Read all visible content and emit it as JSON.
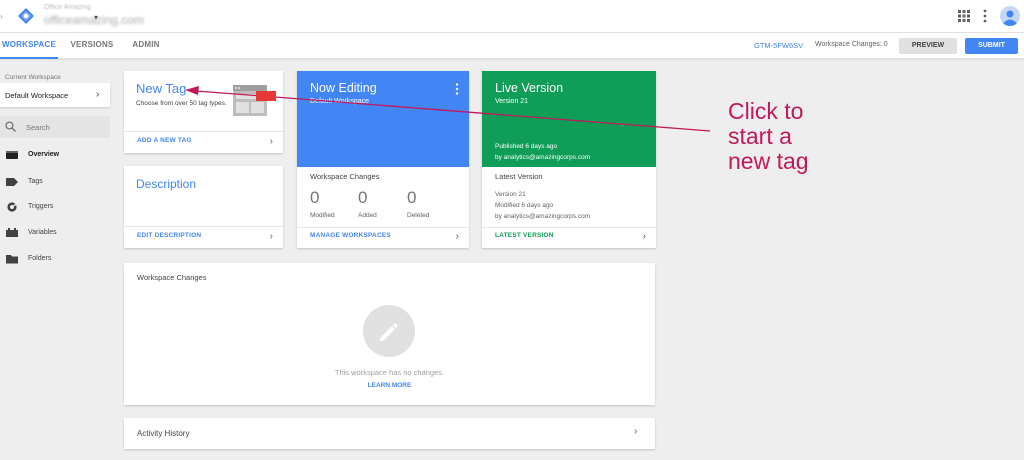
{
  "header": {
    "account_name": "Office Amazing",
    "container_name": "officeamazing.com",
    "caret": "▾",
    "left_edge": "›"
  },
  "tabs": [
    {
      "label": "WORKSPACE",
      "active": true
    },
    {
      "label": "VERSIONS",
      "active": false
    },
    {
      "label": "ADMIN",
      "active": false
    }
  ],
  "toolbar": {
    "container_id": "GTM-5FW6SV",
    "workspace_changes": "Workspace Changes: 0",
    "preview_label": "PREVIEW",
    "submit_label": "SUBMIT"
  },
  "sidebar": {
    "current_workspace_label": "Current Workspace",
    "workspace_name": "Default Workspace",
    "chevron": "›",
    "search_placeholder": "Search",
    "items": [
      {
        "label": "Overview",
        "icon": "overview-icon",
        "active": true
      },
      {
        "label": "Tags",
        "icon": "tag-icon",
        "active": false
      },
      {
        "label": "Triggers",
        "icon": "trigger-icon",
        "active": false
      },
      {
        "label": "Variables",
        "icon": "variables-icon",
        "active": false
      },
      {
        "label": "Folders",
        "icon": "folder-icon",
        "active": false
      }
    ]
  },
  "cards": {
    "new_tag": {
      "title": "New Tag",
      "subtitle": "Choose from over 50 tag types.",
      "link": "ADD A NEW TAG"
    },
    "description": {
      "title": "Description",
      "link": "EDIT DESCRIPTION"
    },
    "now_editing": {
      "title": "Now Editing",
      "subtitle": "Default Workspace",
      "changes_label": "Workspace Changes",
      "stats": [
        {
          "value": "0",
          "label": "Modified"
        },
        {
          "value": "0",
          "label": "Added"
        },
        {
          "value": "0",
          "label": "Deleted"
        }
      ],
      "link": "MANAGE WORKSPACES"
    },
    "live_version": {
      "title": "Live Version",
      "version": "Version 21",
      "published": "Published 6 days ago",
      "published_by": "by analytics@amazingcorps.com",
      "latest_label": "Latest Version",
      "latest_version": "Version 21",
      "modified": "Modified 6 days ago",
      "modified_by": "by analytics@amazingcorps.com",
      "link": "LATEST VERSION"
    },
    "workspace_changes": {
      "title": "Workspace Changes",
      "empty_text": "This workspace has no changes.",
      "learn_more": "LEARN MORE"
    },
    "activity_history": {
      "title": "Activity History"
    }
  },
  "annotation": {
    "lines": [
      "Click to",
      "start a",
      "new tag"
    ],
    "color": "#c2185b"
  },
  "colors": {
    "accent_blue": "#4285f4",
    "live_green": "#0f9d58",
    "arrow_red": "#e53935"
  }
}
